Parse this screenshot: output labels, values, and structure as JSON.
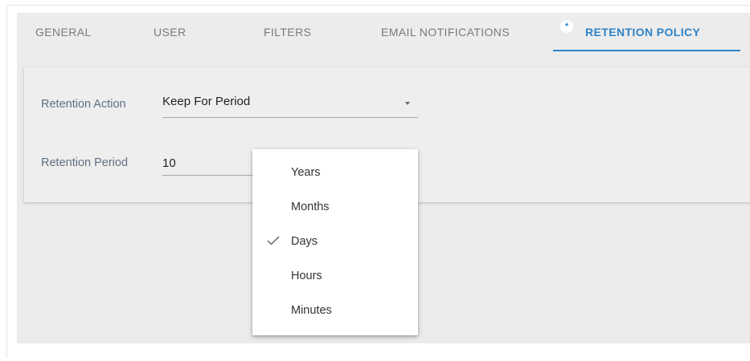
{
  "tabs": [
    {
      "label": "GENERAL"
    },
    {
      "label": "USER"
    },
    {
      "label": "FILTERS"
    },
    {
      "label": "EMAIL NOTIFICATIONS"
    },
    {
      "label": "RETENTION POLICY"
    }
  ],
  "active_tab_badge": "*",
  "form": {
    "retention_action": {
      "label": "Retention Action",
      "value": "Keep For Period"
    },
    "retention_period": {
      "label": "Retention Period",
      "value": "10"
    }
  },
  "unit_menu": {
    "options": [
      "Years",
      "Months",
      "Days",
      "Hours",
      "Minutes"
    ],
    "selected": "Days"
  },
  "colors": {
    "accent": "#2d83c8",
    "background": "#ebebeb"
  },
  "icons": {
    "check": "check-icon",
    "dropdown": "chevron-down-icon",
    "badge": "star-icon"
  }
}
